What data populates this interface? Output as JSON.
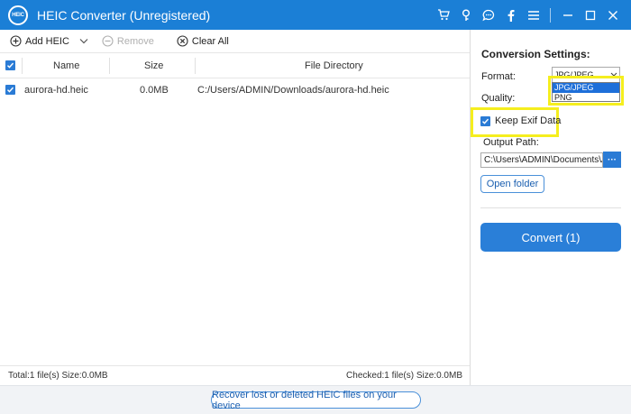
{
  "titlebar": {
    "logo_text": "HEIC",
    "title": "HEIC Converter (Unregistered)",
    "icons": [
      "cart-icon",
      "key-icon",
      "chat-icon",
      "facebook-icon",
      "menu-icon",
      "minimize-icon",
      "maximize-icon",
      "close-icon"
    ]
  },
  "toolbar": {
    "add_label": "Add HEIC",
    "remove_label": "Remove",
    "clear_label": "Clear All"
  },
  "table": {
    "columns": [
      "Name",
      "Size",
      "File Directory"
    ],
    "rows": [
      {
        "checked": true,
        "name": "aurora-hd.heic",
        "size": "0.0MB",
        "directory": "C:/Users/ADMIN/Downloads/aurora-hd.heic"
      }
    ]
  },
  "status": {
    "total": "Total:1 file(s) Size:0.0MB",
    "checked": "Checked:1 file(s) Size:0.0MB"
  },
  "footer": {
    "recover_label": "Recover lost or deleted HEIC files on your device"
  },
  "settings": {
    "title": "Conversion Settings:",
    "format_label": "Format:",
    "format_value": "JPG/JPEG",
    "format_options": [
      "JPG/JPEG",
      "PNG"
    ],
    "quality_label": "Quality:",
    "exif_label": "Keep Exif Data",
    "exif_checked": true,
    "output_label": "Output Path:",
    "output_path": "C:\\Users\\ADMIN\\Documents\\Ap",
    "browse_label": "···",
    "open_folder_label": "Open folder",
    "convert_label": "Convert (1)"
  },
  "colors": {
    "titlebar": "#1b7fd6",
    "accent": "#2a7fd8",
    "highlight": "#f5ee1e"
  }
}
